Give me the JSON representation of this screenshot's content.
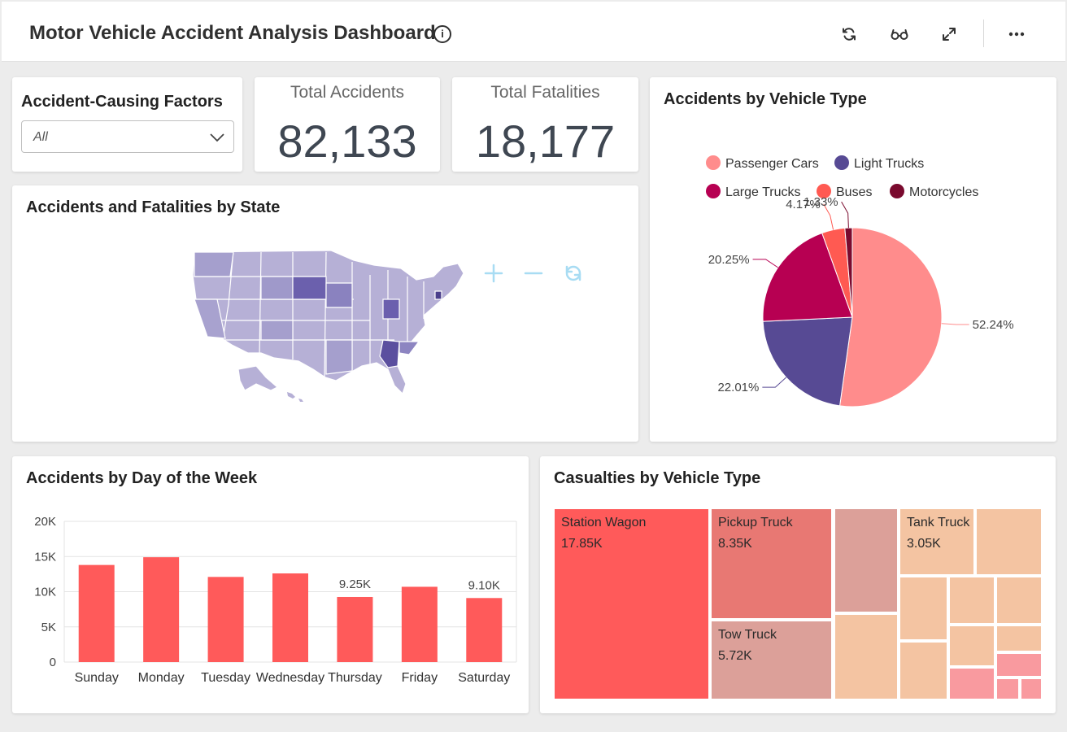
{
  "header": {
    "title": "Motor Vehicle Accident Analysis Dashboard",
    "info_glyph": "i",
    "icons": [
      "info-icon",
      "refresh-icon",
      "glasses-icon",
      "expand-icon",
      "more-icon"
    ]
  },
  "filter": {
    "title": "Accident-Causing Factors",
    "selected": "All"
  },
  "kpis": {
    "total_accidents_label": "Total Accidents",
    "total_accidents_value": "82,133",
    "total_fatalities_label": "Total Fatalities",
    "total_fatalities_value": "18,177"
  },
  "map": {
    "title": "Accidents and Fatalities by State",
    "controls": [
      "zoom-in-icon",
      "zoom-out-icon",
      "reset-icon"
    ]
  },
  "vehicle_pie": {
    "title": "Accidents by Vehicle Type"
  },
  "weekday_bar": {
    "title": "Accidents by Day of the Week"
  },
  "treemap": {
    "title": "Casualties by Vehicle Type"
  },
  "chart_data": [
    {
      "type": "pie",
      "title": "Accidents by Vehicle Type",
      "legend_position": "top",
      "slices": [
        {
          "name": "Passenger Cars",
          "value": 52.24,
          "label": "52.24%",
          "color": "#ff8c8c"
        },
        {
          "name": "Light Trucks",
          "value": 22.01,
          "label": "22.01%",
          "color": "#574a94"
        },
        {
          "name": "Large Trucks",
          "value": 20.25,
          "label": "20.25%",
          "color": "#b70052"
        },
        {
          "name": "Buses",
          "value": 4.17,
          "label": "4.17%",
          "color": "#ff5a52"
        },
        {
          "name": "Motorcycles",
          "value": 1.33,
          "label": "1.33%",
          "color": "#7a0a2e"
        }
      ]
    },
    {
      "type": "bar",
      "title": "Accidents by Day of the Week",
      "categories": [
        "Sunday",
        "Monday",
        "Tuesday",
        "Wednesday",
        "Thursday",
        "Friday",
        "Saturday"
      ],
      "values": [
        13800,
        14900,
        12100,
        12600,
        9250,
        10700,
        9100
      ],
      "data_labels": {
        "4": "9.25K",
        "6": "9.10K"
      },
      "y_ticks": [
        "0",
        "5K",
        "10K",
        "15K",
        "20K"
      ],
      "ylim": [
        0,
        20000
      ],
      "grid": true,
      "bar_color": "#ff5a5a"
    },
    {
      "type": "treemap",
      "title": "Casualties by Vehicle Type",
      "leaves": [
        {
          "name": "Station Wagon",
          "value_label": "17.85K",
          "color": "#ff5a5a"
        },
        {
          "name": "Pickup Truck",
          "value_label": "8.35K",
          "color": "#e87873"
        },
        {
          "name": "Tow Truck",
          "value_label": "5.72K",
          "color": "#dca099"
        },
        {
          "name": "Tank Truck",
          "value_label": "3.05K",
          "color": "#f4c4a2"
        },
        {
          "name": "",
          "value_label": "",
          "color": "#dca099"
        },
        {
          "name": "",
          "value_label": "",
          "color": "#f4c4a2"
        },
        {
          "name": "",
          "value_label": "",
          "color": "#f4c4a2"
        },
        {
          "name": "",
          "value_label": "",
          "color": "#f4c4a2"
        },
        {
          "name": "",
          "value_label": "",
          "color": "#f4c4a2"
        },
        {
          "name": "",
          "value_label": "",
          "color": "#f4c4a2"
        },
        {
          "name": "",
          "value_label": "",
          "color": "#f4c4a2"
        },
        {
          "name": "",
          "value_label": "",
          "color": "#f4c4a2"
        },
        {
          "name": "",
          "value_label": "",
          "color": "#f4c4a2"
        },
        {
          "name": "",
          "value_label": "",
          "color": "#f99a9f"
        },
        {
          "name": "",
          "value_label": "",
          "color": "#f99a9f"
        },
        {
          "name": "",
          "value_label": "",
          "color": "#f99a9f"
        },
        {
          "name": "",
          "value_label": "",
          "color": "#f99a9f"
        }
      ]
    }
  ]
}
